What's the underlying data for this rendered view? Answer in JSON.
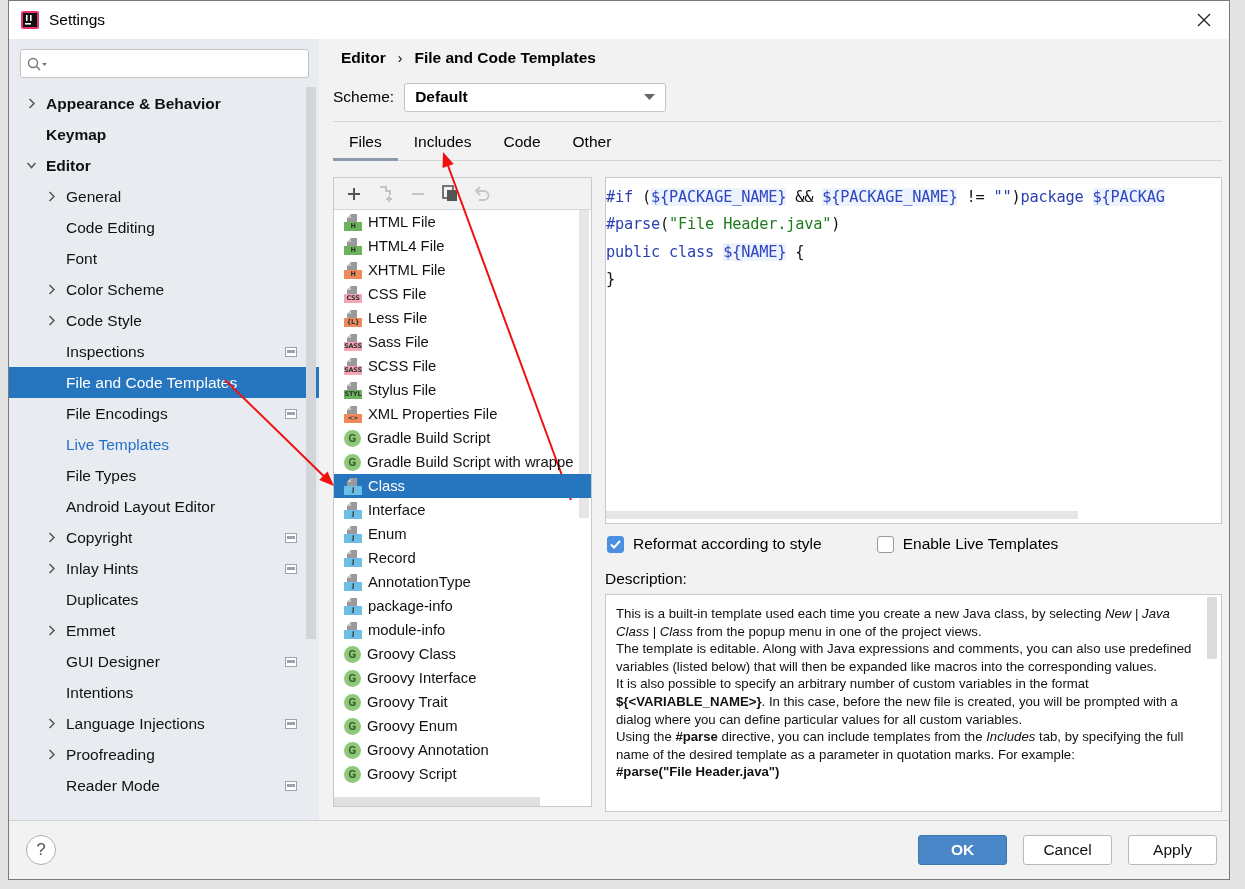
{
  "window": {
    "title": "Settings"
  },
  "sidebar": {
    "items": [
      {
        "label": "Appearance & Behavior",
        "kind": "group",
        "expanded": false,
        "selected": false,
        "scoped": false,
        "modified": false
      },
      {
        "label": "Keymap",
        "kind": "leaf",
        "selected": false,
        "scoped": false,
        "modified": false
      },
      {
        "label": "Editor",
        "kind": "group",
        "expanded": true,
        "selected": false,
        "scoped": false,
        "modified": false,
        "children": [
          {
            "label": "General",
            "kind": "group",
            "expanded": false,
            "selected": false,
            "scoped": false,
            "modified": false
          },
          {
            "label": "Code Editing",
            "kind": "leaf",
            "selected": false,
            "scoped": false,
            "modified": false
          },
          {
            "label": "Font",
            "kind": "leaf",
            "selected": false,
            "scoped": false,
            "modified": false
          },
          {
            "label": "Color Scheme",
            "kind": "group",
            "expanded": false,
            "selected": false,
            "scoped": false,
            "modified": false
          },
          {
            "label": "Code Style",
            "kind": "group",
            "expanded": false,
            "selected": false,
            "scoped": false,
            "modified": false
          },
          {
            "label": "Inspections",
            "kind": "leaf",
            "selected": false,
            "scoped": true,
            "modified": false
          },
          {
            "label": "File and Code Templates",
            "kind": "leaf",
            "selected": true,
            "scoped": false,
            "modified": false
          },
          {
            "label": "File Encodings",
            "kind": "leaf",
            "selected": false,
            "scoped": true,
            "modified": false
          },
          {
            "label": "Live Templates",
            "kind": "leaf",
            "selected": false,
            "scoped": false,
            "modified": true
          },
          {
            "label": "File Types",
            "kind": "leaf",
            "selected": false,
            "scoped": false,
            "modified": false
          },
          {
            "label": "Android Layout Editor",
            "kind": "leaf",
            "selected": false,
            "scoped": false,
            "modified": false
          },
          {
            "label": "Copyright",
            "kind": "group",
            "expanded": false,
            "selected": false,
            "scoped": true,
            "modified": false
          },
          {
            "label": "Inlay Hints",
            "kind": "group",
            "expanded": false,
            "selected": false,
            "scoped": true,
            "modified": false
          },
          {
            "label": "Duplicates",
            "kind": "leaf",
            "selected": false,
            "scoped": false,
            "modified": false
          },
          {
            "label": "Emmet",
            "kind": "group",
            "expanded": false,
            "selected": false,
            "scoped": false,
            "modified": false
          },
          {
            "label": "GUI Designer",
            "kind": "leaf",
            "selected": false,
            "scoped": true,
            "modified": false
          },
          {
            "label": "Intentions",
            "kind": "leaf",
            "selected": false,
            "scoped": false,
            "modified": false
          },
          {
            "label": "Language Injections",
            "kind": "group",
            "expanded": false,
            "selected": false,
            "scoped": true,
            "modified": false
          },
          {
            "label": "Proofreading",
            "kind": "group",
            "expanded": false,
            "selected": false,
            "scoped": false,
            "modified": false
          },
          {
            "label": "Reader Mode",
            "kind": "leaf",
            "selected": false,
            "scoped": true,
            "modified": false
          }
        ]
      }
    ]
  },
  "breadcrumb": [
    "Editor",
    "File and Code Templates"
  ],
  "breadcrumb_separator": "›",
  "scheme": {
    "label": "Scheme:",
    "value": "Default"
  },
  "tabs": [
    {
      "label": "Files",
      "selected": true
    },
    {
      "label": "Includes",
      "selected": false
    },
    {
      "label": "Code",
      "selected": false
    },
    {
      "label": "Other",
      "selected": false
    }
  ],
  "toolbar": [
    {
      "kind": "add",
      "disabled": false
    },
    {
      "kind": "add-copy",
      "disabled": true
    },
    {
      "kind": "remove",
      "disabled": true
    },
    {
      "kind": "copy",
      "disabled": false
    },
    {
      "kind": "reset",
      "disabled": true
    }
  ],
  "templates": [
    {
      "label": "HTML File",
      "kind": "file",
      "badge": "H",
      "color": "#6cb35b",
      "selected": false
    },
    {
      "label": "HTML4 File",
      "kind": "file",
      "badge": "H",
      "color": "#6cb35b",
      "selected": false
    },
    {
      "label": "XHTML File",
      "kind": "file",
      "badge": "H",
      "color": "#f08a5d",
      "selected": false
    },
    {
      "label": "CSS File",
      "kind": "file",
      "badge": "CSS",
      "color": "#f4a6b5",
      "selected": false
    },
    {
      "label": "Less File",
      "kind": "file",
      "badge": "{L}",
      "color": "#f08a5d",
      "selected": false
    },
    {
      "label": "Sass File",
      "kind": "file",
      "badge": "SASS",
      "color": "#f4a6b5",
      "selected": false
    },
    {
      "label": "SCSS File",
      "kind": "file",
      "badge": "SASS",
      "color": "#f4a6b5",
      "selected": false
    },
    {
      "label": "Stylus File",
      "kind": "file",
      "badge": "STYL",
      "color": "#6cb35b",
      "selected": false
    },
    {
      "label": "XML Properties File",
      "kind": "file",
      "badge": "<>",
      "color": "#f08a5d",
      "selected": false
    },
    {
      "label": "Gradle Build Script",
      "kind": "circle",
      "badge": "G",
      "color": "#8fc87a",
      "selected": false
    },
    {
      "label": "Gradle Build Script with wrappe",
      "kind": "circle",
      "badge": "G",
      "color": "#8fc87a",
      "selected": false
    },
    {
      "label": "Class",
      "kind": "file",
      "badge": "J",
      "color": "#6bbfe6",
      "selected": true
    },
    {
      "label": "Interface",
      "kind": "file",
      "badge": "J",
      "color": "#6bbfe6",
      "selected": false
    },
    {
      "label": "Enum",
      "kind": "file",
      "badge": "J",
      "color": "#6bbfe6",
      "selected": false
    },
    {
      "label": "Record",
      "kind": "file",
      "badge": "J",
      "color": "#6bbfe6",
      "selected": false
    },
    {
      "label": "AnnotationType",
      "kind": "file",
      "badge": "J",
      "color": "#6bbfe6",
      "selected": false
    },
    {
      "label": "package-info",
      "kind": "file",
      "badge": "J",
      "color": "#6bbfe6",
      "selected": false
    },
    {
      "label": "module-info",
      "kind": "file",
      "badge": "J",
      "color": "#6bbfe6",
      "selected": false
    },
    {
      "label": "Groovy Class",
      "kind": "circle",
      "badge": "G",
      "color": "#8fc87a",
      "selected": false
    },
    {
      "label": "Groovy Interface",
      "kind": "circle",
      "badge": "G",
      "color": "#8fc87a",
      "selected": false
    },
    {
      "label": "Groovy Trait",
      "kind": "circle",
      "badge": "G",
      "color": "#8fc87a",
      "selected": false
    },
    {
      "label": "Groovy Enum",
      "kind": "circle",
      "badge": "G",
      "color": "#8fc87a",
      "selected": false
    },
    {
      "label": "Groovy Annotation",
      "kind": "circle",
      "badge": "G",
      "color": "#8fc87a",
      "selected": false
    },
    {
      "label": "Groovy Script",
      "kind": "circle",
      "badge": "G",
      "color": "#8fc87a",
      "selected": false
    }
  ],
  "code": [
    [
      {
        "text": "#if",
        "kind": "directive"
      },
      {
        "text": " (",
        "kind": "plain"
      },
      {
        "text": "${PACKAGE_NAME}",
        "kind": "var"
      },
      {
        "text": " && ",
        "kind": "plain"
      },
      {
        "text": "${PACKAGE_NAME}",
        "kind": "var"
      },
      {
        "text": " != ",
        "kind": "plain"
      },
      {
        "text": "\"\"",
        "kind": "keyword"
      },
      {
        "text": ")",
        "kind": "plain"
      },
      {
        "text": "package ",
        "kind": "keyword"
      },
      {
        "text": "${PACKAG",
        "kind": "var"
      }
    ],
    [
      {
        "text": "#parse",
        "kind": "directive"
      },
      {
        "text": "(",
        "kind": "plain"
      },
      {
        "text": "\"File Header.java\"",
        "kind": "string"
      },
      {
        "text": ")",
        "kind": "plain"
      }
    ],
    [
      {
        "text": "public class ",
        "kind": "keyword"
      },
      {
        "text": "${NAME}",
        "kind": "var"
      },
      {
        "text": " {",
        "kind": "plain"
      }
    ],
    [
      {
        "text": "}",
        "kind": "plain"
      }
    ]
  ],
  "options": [
    {
      "label": "Reformat according to style",
      "checked": true
    },
    {
      "label": "Enable Live Templates",
      "checked": false
    }
  ],
  "description": {
    "label": "Description:",
    "paragraphs": [
      {
        "text": "This is a built-in template used each time you create a new Java class, by selecting *New* | *Java Class* | *Class* from the popup menu in one of the project views.",
        "bold": false
      },
      {
        "text": "The template is editable. Along with Java expressions and comments, you can also use predefined variables (listed below) that will then be expanded like macros into the corresponding values.",
        "bold": false
      },
      {
        "text": "It is also possible to specify an arbitrary number of custom variables in the format **${<VARIABLE_NAME>}**. In this case, before the new file is created, you will be prompted with a dialog where you can define particular values for all custom variables.",
        "bold": false
      },
      {
        "text": "Using the **#parse** directive, you can include templates from the *Includes* tab, by specifying the full name of the desired template as a parameter in quotation marks. For example:",
        "bold": false
      },
      {
        "text": "#parse(\"File Header.java\")",
        "bold": true
      }
    ]
  },
  "help": {
    "label": "?"
  },
  "buttons": [
    {
      "label": "OK",
      "kind": "primary"
    },
    {
      "label": "Cancel",
      "kind": "normal"
    },
    {
      "label": "Apply",
      "kind": "normal"
    }
  ]
}
